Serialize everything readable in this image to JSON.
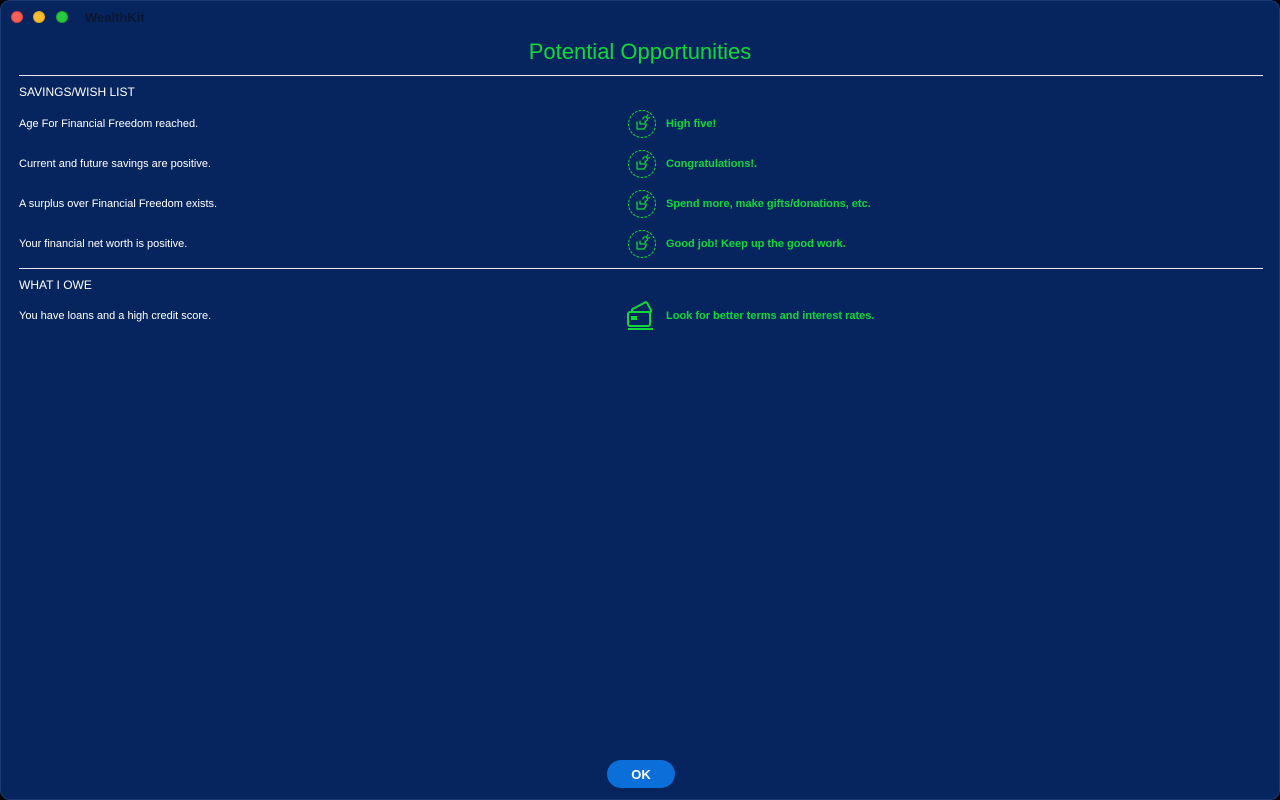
{
  "window": {
    "app_title": "WealthKit"
  },
  "page": {
    "title": "Potential Opportunities"
  },
  "sections": {
    "savings": {
      "title": "SAVINGS/WISH LIST",
      "rows": [
        {
          "label": "Age For Financial Freedom reached.",
          "message": "High five!",
          "icon": "high-five-icon"
        },
        {
          "label": "Current and future savings are positive.",
          "message": "Congratulations!.",
          "icon": "high-five-icon"
        },
        {
          "label": "A surplus over Financial Freedom exists.",
          "message": "Spend more, make gifts/donations, etc.",
          "icon": "high-five-icon"
        },
        {
          "label": "Your financial net worth is positive.",
          "message": "Good job!  Keep up the good work.",
          "icon": "high-five-icon"
        }
      ]
    },
    "owe": {
      "title": "WHAT I OWE",
      "rows": [
        {
          "label": "You have loans and a high credit score.",
          "message": "Look for better terms and interest rates.",
          "icon": "credit-card-icon"
        }
      ]
    }
  },
  "footer": {
    "ok_label": "OK"
  },
  "colors": {
    "background": "#06255f",
    "accent_green": "#10d83a",
    "button_blue": "#0a6fd9",
    "text_white": "#ffffff"
  }
}
